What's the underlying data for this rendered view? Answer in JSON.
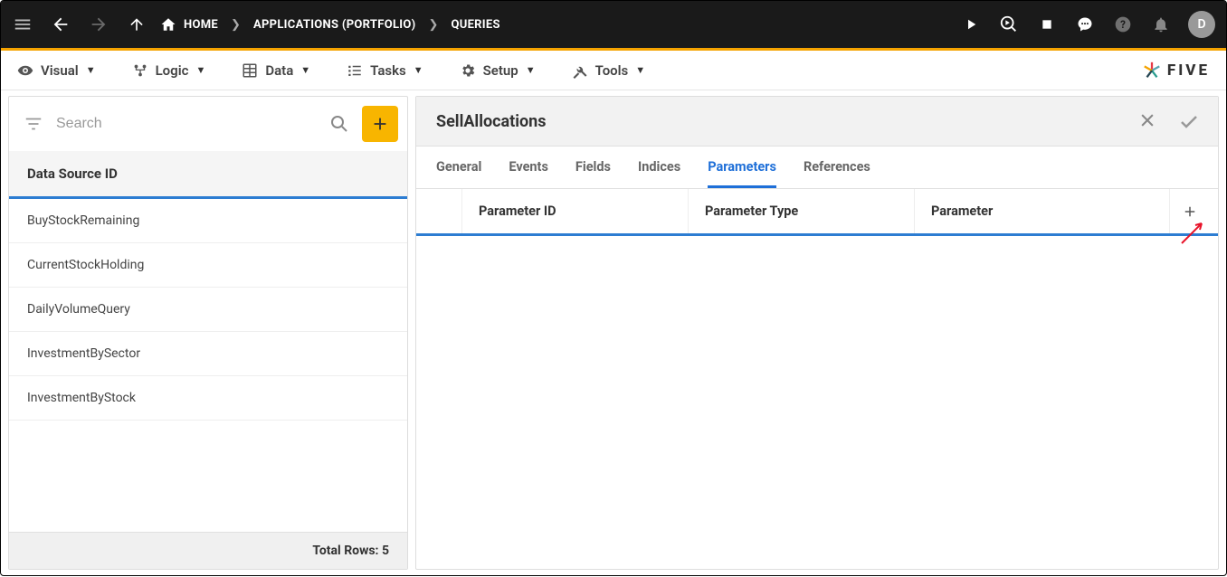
{
  "breadcrumbs": {
    "home": "HOME",
    "apps": "APPLICATIONS (PORTFOLIO)",
    "queries": "QUERIES"
  },
  "avatar": {
    "letter": "D"
  },
  "menus": {
    "visual": "Visual",
    "logic": "Logic",
    "data": "Data",
    "tasks": "Tasks",
    "setup": "Setup",
    "tools": "Tools"
  },
  "logo_text": "FIVE",
  "left": {
    "search_placeholder": "Search",
    "column_header": "Data Source ID",
    "rows": [
      "BuyStockRemaining",
      "CurrentStockHolding",
      "DailyVolumeQuery",
      "InvestmentBySector",
      "InvestmentByStock"
    ],
    "footer": "Total Rows: 5"
  },
  "detail": {
    "title": "SellAllocations",
    "tabs": {
      "general": "General",
      "events": "Events",
      "fields": "Fields",
      "indices": "Indices",
      "parameters": "Parameters",
      "references": "References"
    },
    "param_cols": {
      "id": "Parameter ID",
      "type": "Parameter Type",
      "param": "Parameter"
    }
  }
}
